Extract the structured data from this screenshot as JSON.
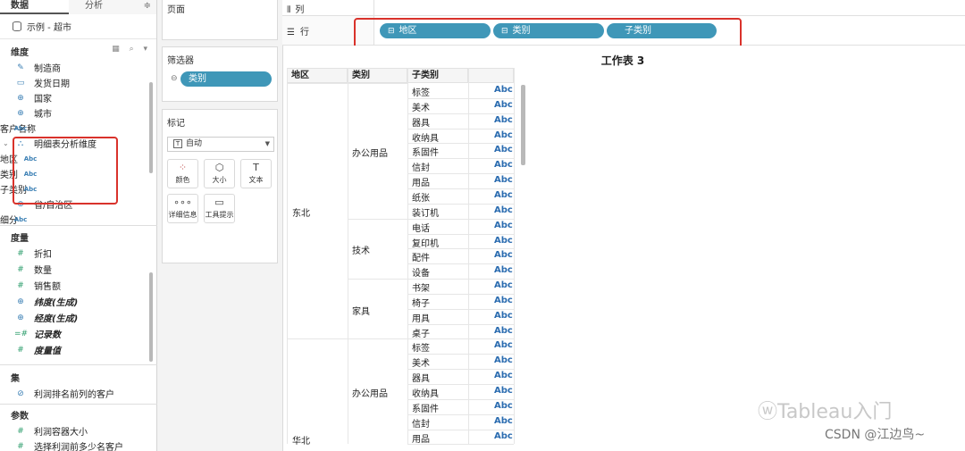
{
  "left_pane": {
    "tab_data": "数据",
    "tab_analysis": "分析",
    "tab_menu": "≑",
    "data_source": "示例 - 超市",
    "dimensions_title": "维度",
    "dimension_tools": "▦ ⌕ ▾",
    "dimensions": [
      {
        "icon": "✎",
        "label": "制造商"
      },
      {
        "icon": "▭",
        "label": "发货日期"
      },
      {
        "icon": "⊕",
        "label": "国家"
      },
      {
        "icon": "⊕",
        "label": "城市"
      },
      {
        "icon": "Abc",
        "label": "客户名称"
      },
      {
        "icon": "⛬",
        "label": "明细表分析维度"
      },
      {
        "icon": "Abc",
        "label": "地区"
      },
      {
        "icon": "Abc",
        "label": "类别"
      },
      {
        "icon": "Abc",
        "label": "子类别"
      },
      {
        "icon": "⊕",
        "label": "省/自治区"
      },
      {
        "icon": "Abc",
        "label": "细分"
      }
    ],
    "measures_title": "度量",
    "measures": [
      {
        "icon": "#",
        "label": "折扣"
      },
      {
        "icon": "#",
        "label": "数量"
      },
      {
        "icon": "#",
        "label": "销售额"
      },
      {
        "icon": "⊕",
        "label": "纬度(生成)"
      },
      {
        "icon": "⊕",
        "label": "经度(生成)"
      },
      {
        "icon": "=#",
        "label": "记录数"
      },
      {
        "icon": "#",
        "label": "度量值"
      }
    ],
    "sets_title": "集",
    "sets": [
      {
        "icon": "⊘",
        "label": "利润排名前列的客户"
      }
    ],
    "params_title": "参数",
    "params": [
      {
        "icon": "#",
        "label": "利润容器大小"
      },
      {
        "icon": "#",
        "label": "选择利润前多少名客户"
      }
    ]
  },
  "mid_pane": {
    "pages_title": "页面",
    "filters_title": "筛选器",
    "filter_pill": "类别",
    "marks_title": "标记",
    "mark_type": "自动",
    "mark_buttons": [
      {
        "label": "颜色",
        "glyph": "⁘"
      },
      {
        "label": "大小",
        "glyph": "⬡"
      },
      {
        "label": "文本",
        "glyph": "T"
      },
      {
        "label": "详细信息",
        "glyph": "∘∘∘"
      },
      {
        "label": "工具提示",
        "glyph": "▭"
      }
    ]
  },
  "shelves": {
    "columns_label": "列",
    "rows_label": "行",
    "row_pills": [
      "地区",
      "类别",
      "子类别"
    ]
  },
  "view": {
    "title": "工作表 3",
    "headers": [
      "地区",
      "类别",
      "子类别"
    ],
    "abc": "Abc",
    "regions": [
      {
        "name": "东北",
        "categories": [
          {
            "name": "办公用品",
            "subs": [
              "标签",
              "美术",
              "器具",
              "收纳具",
              "系固件",
              "信封",
              "用品",
              "纸张",
              "装订机"
            ]
          },
          {
            "name": "技术",
            "subs": [
              "电话",
              "复印机",
              "配件",
              "设备"
            ]
          },
          {
            "name": "家具",
            "subs": [
              "书架",
              "椅子",
              "用具",
              "桌子"
            ]
          }
        ]
      },
      {
        "name": "华北",
        "categories": [
          {
            "name": "办公用品",
            "subs": [
              "标签",
              "美术",
              "器具",
              "收纳具",
              "系固件",
              "信封",
              "用品"
            ]
          }
        ]
      }
    ]
  },
  "watermark": {
    "line1": "Tableau入门",
    "line2": "CSDN @江边鸟~"
  },
  "colors": {
    "pill": "#3f97b8",
    "highlight": "#d9322b",
    "abc": "#2b6cb0"
  }
}
